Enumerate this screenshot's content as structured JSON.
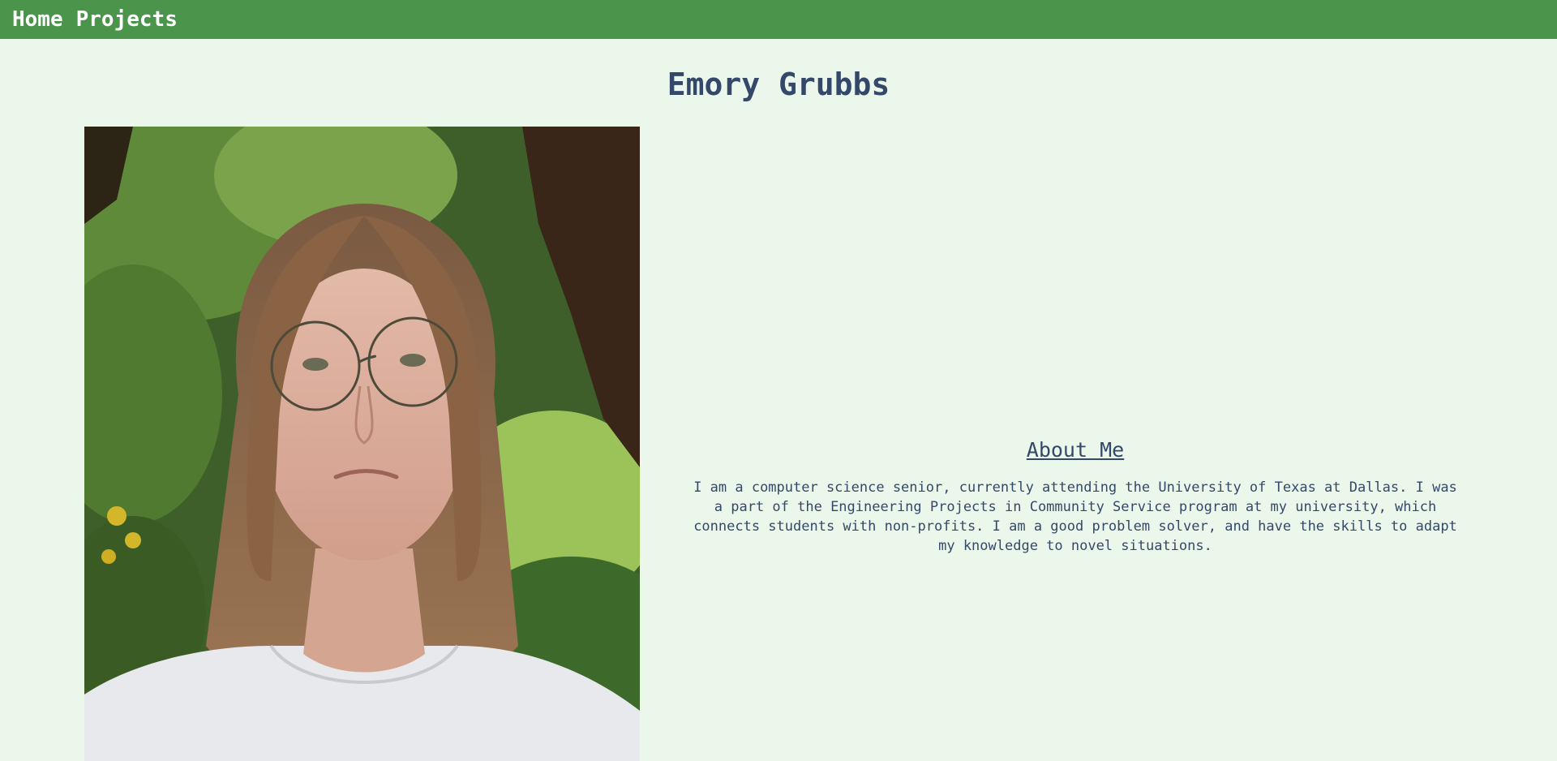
{
  "nav": {
    "links": [
      {
        "label": "Home"
      },
      {
        "label": "Projects"
      }
    ],
    "background": "#4a944c"
  },
  "page": {
    "title": "Emory Grubbs",
    "background": "#ecf7ec",
    "text_color": "#34486a"
  },
  "portrait": {
    "icon": "portrait-photo"
  },
  "about": {
    "heading": "About Me",
    "body": "I am a computer science senior, currently attending the University of Texas at Dallas. I was a part of the Engineering Projects in Community Service program at my university, which connects students with non-profits. I am a good problem solver, and have the skills to adapt my knowledge to novel situations."
  }
}
